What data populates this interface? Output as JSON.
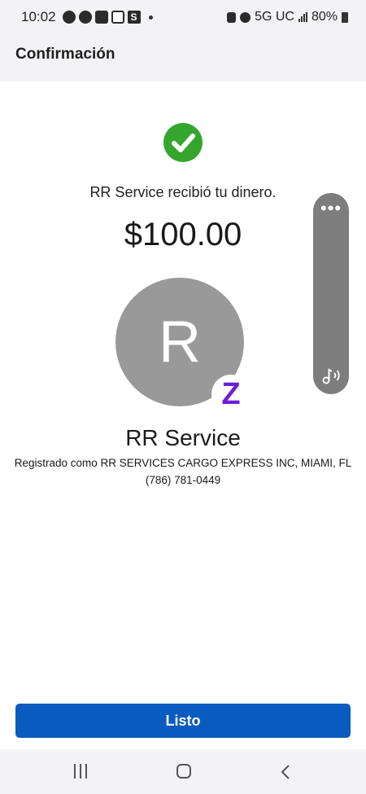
{
  "status_bar": {
    "time": "10:02",
    "network": "5G UC",
    "battery": "80%",
    "app_icons": [
      "messenger-icon",
      "chase-icon",
      "message-icon",
      "instagram-icon",
      "s-icon"
    ]
  },
  "header": {
    "title": "Confirmación"
  },
  "confirmation": {
    "message": "RR Service recibió tu dinero.",
    "amount": "$100.00"
  },
  "recipient": {
    "initial": "R",
    "name": "RR Service",
    "registered": "Registrado como RR SERVICES CARGO EXPRESS INC, MIAMI, FL",
    "phone": "(786) 781-0449",
    "badge": "Z"
  },
  "side_panel": {
    "menu": "•••"
  },
  "actions": {
    "done_label": "Listo"
  },
  "colors": {
    "success_green": "#35a52e",
    "primary_blue": "#0a5bbf",
    "zelle_purple": "#6d1ed4",
    "avatar_gray": "#999999"
  }
}
